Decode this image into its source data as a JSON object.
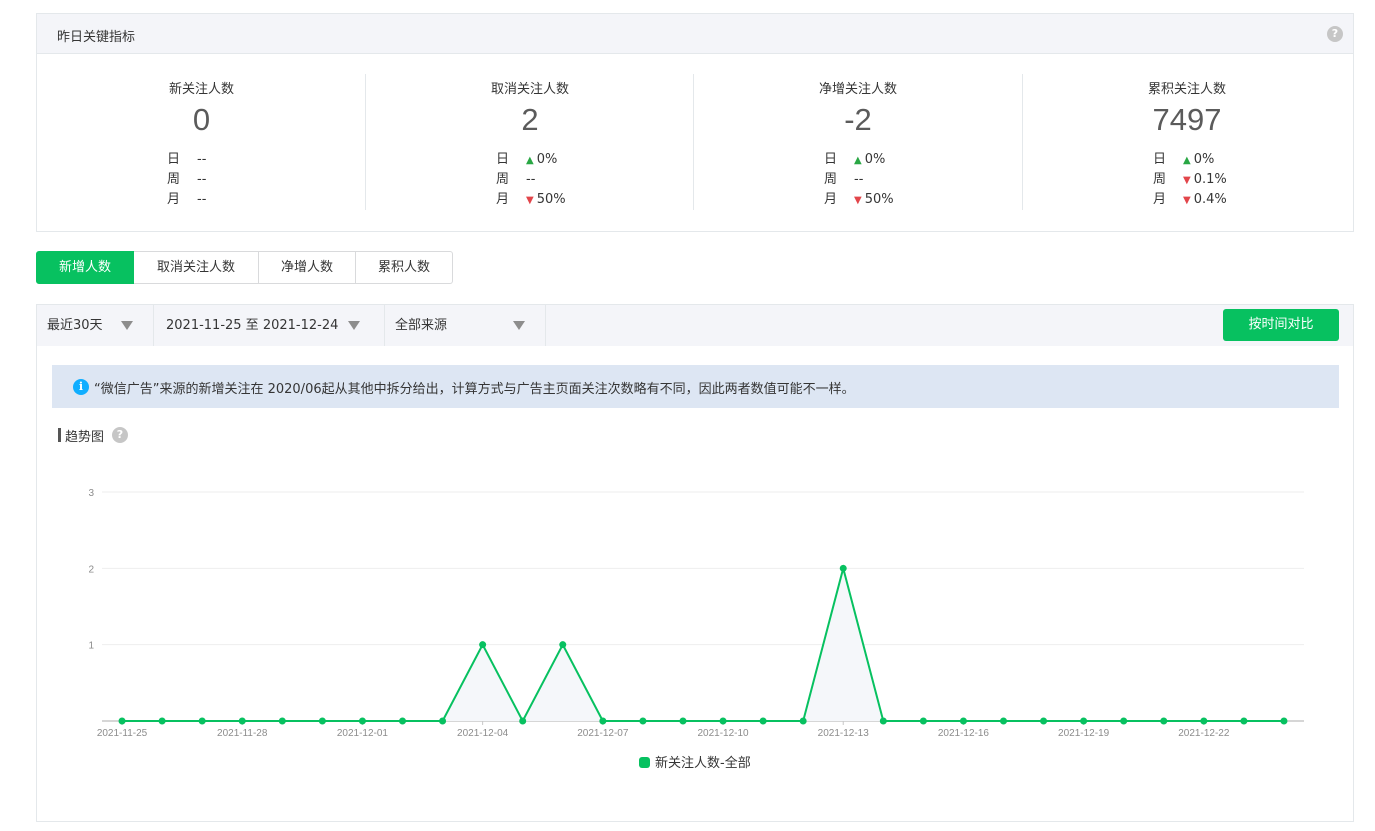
{
  "metrics": {
    "title": "昨日关键指标",
    "help": "?",
    "items": [
      {
        "label": "新关注人数",
        "value": "0",
        "rows": [
          {
            "label": "日",
            "dir": "",
            "value": "--"
          },
          {
            "label": "周",
            "dir": "",
            "value": "--"
          },
          {
            "label": "月",
            "dir": "",
            "value": "--"
          }
        ]
      },
      {
        "label": "取消关注人数",
        "value": "2",
        "rows": [
          {
            "label": "日",
            "dir": "up",
            "value": "0%"
          },
          {
            "label": "周",
            "dir": "",
            "value": "--"
          },
          {
            "label": "月",
            "dir": "down",
            "value": "50%"
          }
        ]
      },
      {
        "label": "净增关注人数",
        "value": "-2",
        "rows": [
          {
            "label": "日",
            "dir": "up",
            "value": "0%"
          },
          {
            "label": "周",
            "dir": "",
            "value": "--"
          },
          {
            "label": "月",
            "dir": "down",
            "value": "50%"
          }
        ]
      },
      {
        "label": "累积关注人数",
        "value": "7497",
        "rows": [
          {
            "label": "日",
            "dir": "up",
            "value": "0%"
          },
          {
            "label": "周",
            "dir": "down",
            "value": "0.1%"
          },
          {
            "label": "月",
            "dir": "down",
            "value": "0.4%"
          }
        ]
      }
    ]
  },
  "tabs": [
    {
      "label": "新增人数",
      "active": true
    },
    {
      "label": "取消关注人数",
      "active": false
    },
    {
      "label": "净增人数",
      "active": false
    },
    {
      "label": "累积人数",
      "active": false
    }
  ],
  "toolbar": {
    "period": "最近30天",
    "date_range": "2021-11-25 至 2021-12-24",
    "source": "全部来源",
    "compare_button": "按时间对比"
  },
  "notice": {
    "icon": "info-icon",
    "text": "“微信广告”来源的新增关注在 2020/06起从其他中拆分给出，计算方式与广告主页面关注次数略有不同，因此两者数值可能不一样。"
  },
  "trend": {
    "title": "趋势图",
    "help": "?"
  },
  "colors": {
    "accent": "#07c160",
    "up": "#29a744",
    "down": "#e2454a",
    "info": "#10aeff"
  },
  "chart_data": {
    "type": "area",
    "x": [
      "2021-11-25",
      "2021-11-26",
      "2021-11-27",
      "2021-11-28",
      "2021-11-29",
      "2021-11-30",
      "2021-12-01",
      "2021-12-02",
      "2021-12-03",
      "2021-12-04",
      "2021-12-05",
      "2021-12-06",
      "2021-12-07",
      "2021-12-08",
      "2021-12-09",
      "2021-12-10",
      "2021-12-11",
      "2021-12-12",
      "2021-12-13",
      "2021-12-14",
      "2021-12-15",
      "2021-12-16",
      "2021-12-17",
      "2021-12-18",
      "2021-12-19",
      "2021-12-20",
      "2021-12-21",
      "2021-12-22",
      "2021-12-23",
      "2021-12-24"
    ],
    "x_tick_labels": [
      "2021-11-25",
      "2021-11-28",
      "2021-12-01",
      "2021-12-04",
      "2021-12-07",
      "2021-12-10",
      "2021-12-13",
      "2021-12-16",
      "2021-12-19",
      "2021-12-22"
    ],
    "y_ticks": [
      "1",
      "2",
      "3"
    ],
    "ylim": [
      0,
      3
    ],
    "grid": true,
    "legend_position": "bottom-center",
    "series": [
      {
        "name": "新关注人数-全部",
        "color": "#07c160",
        "values": [
          0,
          0,
          0,
          0,
          0,
          0,
          0,
          0,
          0,
          1,
          0,
          1,
          0,
          0,
          0,
          0,
          0,
          0,
          2,
          0,
          0,
          0,
          0,
          0,
          0,
          0,
          0,
          0,
          0,
          0
        ]
      }
    ]
  }
}
